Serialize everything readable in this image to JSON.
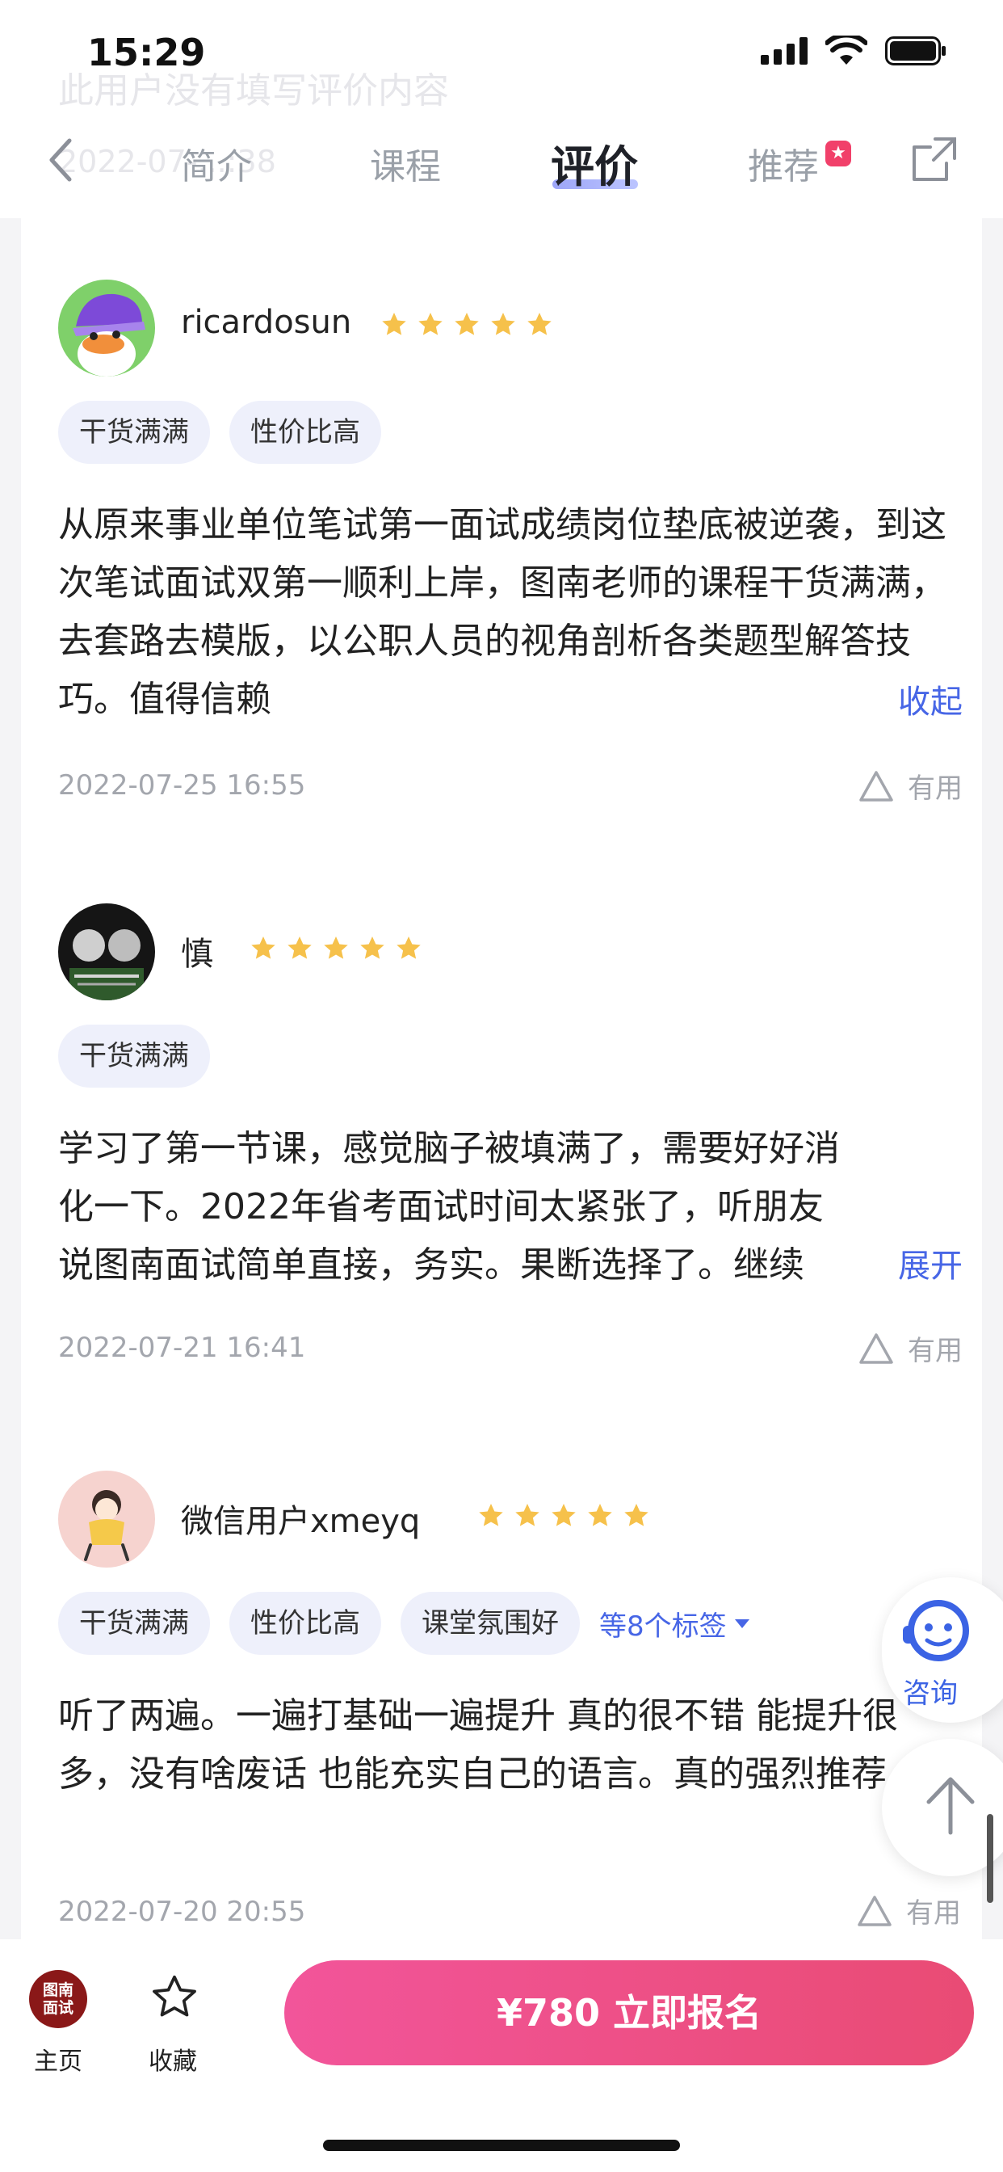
{
  "status_bar": {
    "time": "15:29"
  },
  "header": {
    "ghost_text": "此用户没有填写评价内容",
    "ghost_date": "2022-07-...:38",
    "tabs": [
      {
        "label": "简介",
        "active": false
      },
      {
        "label": "课程",
        "active": false
      },
      {
        "label": "评价",
        "active": true
      },
      {
        "label": "推荐",
        "active": false
      }
    ]
  },
  "reviews": [
    {
      "username": "ricardosun",
      "rating": 5,
      "tags": [
        "干货满满",
        "性价比高"
      ],
      "text": "从原来事业单位笔试第一面试成绩岗位垫底被逆袭，到这次笔试面试双第一顺利上岸，图南老师的课程干货满满，去套路去模版，以公职人员的视角剖析各类题型解答技巧。值得信赖",
      "toggle": "收起",
      "date": "2022-07-25 16:55",
      "useful": "有用"
    },
    {
      "username": "慎",
      "rating": 5,
      "tags": [
        "干货满满"
      ],
      "text": "学习了第一节课，感觉脑子被填满了，需要好好消化一下。2022年省考面试时间太紧张了，听朋友说图南面试简单直接，务实。果断选择了。继续",
      "toggle": "展开",
      "date": "2022-07-21 16:41",
      "useful": "有用"
    },
    {
      "username": "微信用户xmeyq",
      "rating": 5,
      "tags": [
        "干货满满",
        "性价比高",
        "课堂氛围好"
      ],
      "more_tags": "等8个标签",
      "text": "听了两遍。一遍打基础一遍提升 真的很不错 能提升很多，没有啥废话 也能充实自己的语言。真的强烈推荐",
      "date": "2022-07-20 20:55",
      "useful": "有用"
    }
  ],
  "floating": {
    "consult": "咨询"
  },
  "bottom_bar": {
    "logo_text": "图南\n面试",
    "home": "主页",
    "favorite": "收藏",
    "cta": "¥780 立即报名"
  },
  "colors": {
    "accent": "#4766e6",
    "cta_start": "#f2559a",
    "cta_end": "#e94b74",
    "star": "#f6c14b"
  }
}
